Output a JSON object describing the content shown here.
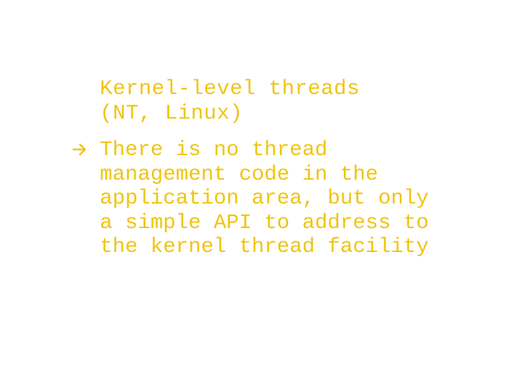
{
  "colors": {
    "accent": "#f1c40f",
    "body": "#f1c40f"
  },
  "title_line1": "Kernel-level threads",
  "title_line2": "(NT, Linux)",
  "bullet_icon": "arrow-right-icon",
  "body_text": "There is no thread management code in the application area, but only a simple API to address to the kernel thread facility"
}
